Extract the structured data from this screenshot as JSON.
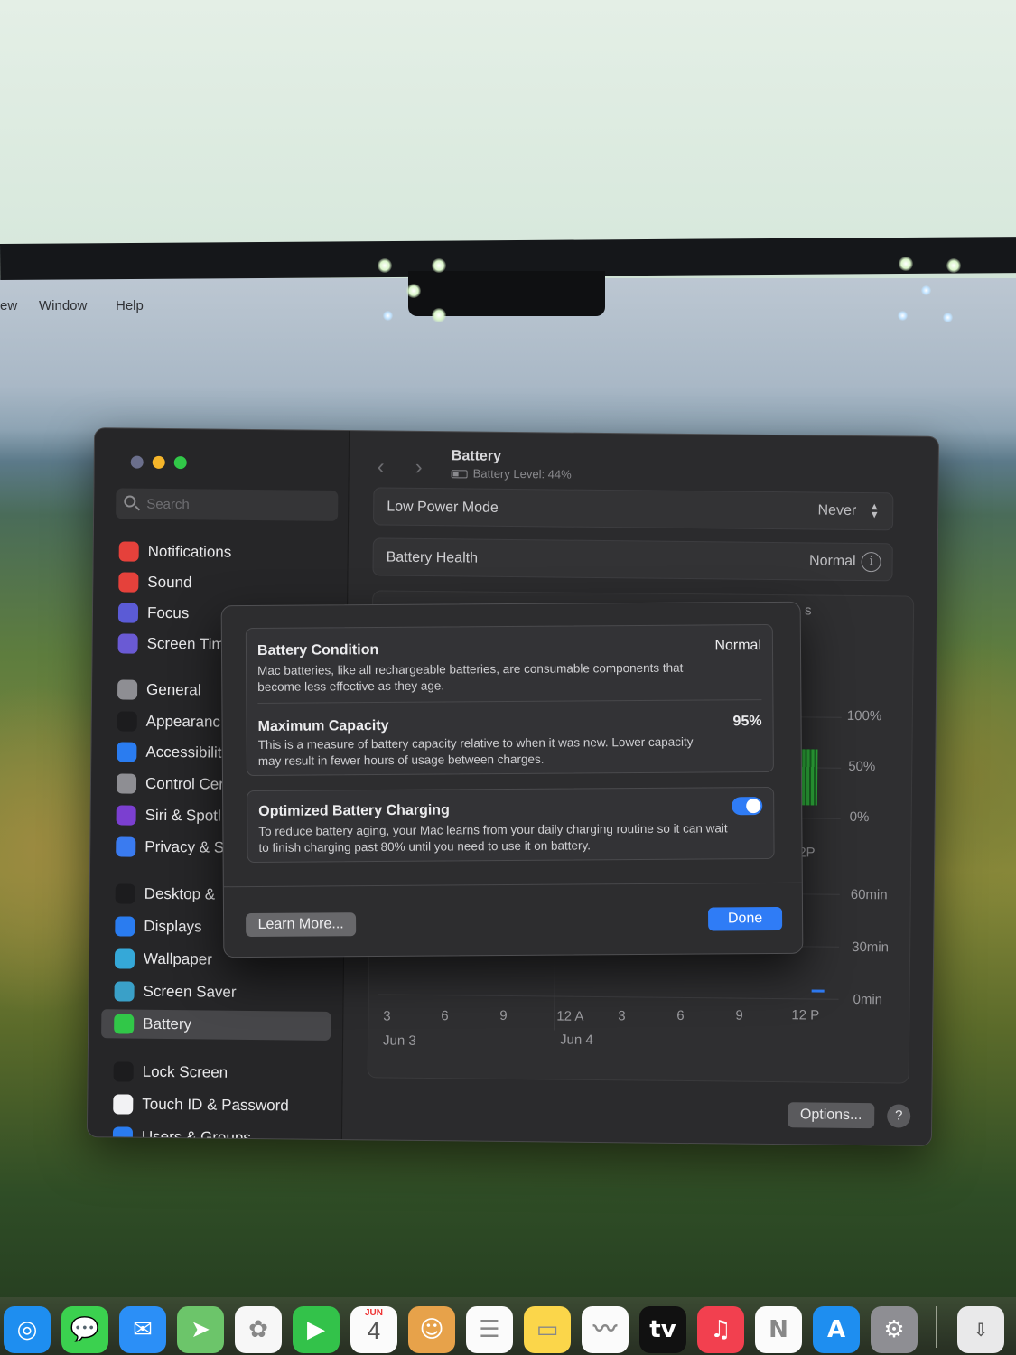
{
  "menubar": {
    "items": [
      "ew",
      "Window",
      "Help"
    ]
  },
  "window": {
    "title": "Battery",
    "subtitle": "Battery Level: 44%",
    "traffic_lights": {
      "close": "#6b6f8c",
      "minimize": "#f5b52a",
      "zoom": "#31c748"
    },
    "search": {
      "placeholder": "Search"
    },
    "sidebar": [
      {
        "label": "Notifications",
        "icon": "bell-icon",
        "color": "#e5413b"
      },
      {
        "label": "Sound",
        "icon": "speaker-icon",
        "color": "#e5413b"
      },
      {
        "label": "Focus",
        "icon": "moon-icon",
        "color": "#5b5bd6"
      },
      {
        "label": "Screen Tim",
        "icon": "hourglass-icon",
        "color": "#6a5ad4"
      },
      {
        "label": "General",
        "icon": "gear-icon",
        "color": "#8e8e93"
      },
      {
        "label": "Appearanc",
        "icon": "appearance-icon",
        "color": "#1c1c1e"
      },
      {
        "label": "Accessibilit",
        "icon": "accessibility-icon",
        "color": "#2a7cf0"
      },
      {
        "label": "Control Cer",
        "icon": "toggles-icon",
        "color": "#8e8e93"
      },
      {
        "label": "Siri & Spotl",
        "icon": "siri-icon",
        "color": "#7b3fd0"
      },
      {
        "label": "Privacy & S",
        "icon": "hand-icon",
        "color": "#3a7bf0"
      },
      {
        "label": "Desktop &",
        "icon": "desktop-icon",
        "color": "#1c1c1e"
      },
      {
        "label": "Displays",
        "icon": "sun-icon",
        "color": "#2a7cf0"
      },
      {
        "label": "Wallpaper",
        "icon": "flower-icon",
        "color": "#35a8d8"
      },
      {
        "label": "Screen Saver",
        "icon": "screensaver-icon",
        "color": "#3aa0c8"
      },
      {
        "label": "Battery",
        "icon": "battery-icon",
        "color": "#31c748",
        "selected": true
      },
      {
        "label": "Lock Screen",
        "icon": "lock-icon",
        "color": "#1c1c1e"
      },
      {
        "label": "Touch ID & Password",
        "icon": "fingerprint-icon",
        "color": "#f2f2f4"
      },
      {
        "label": "Users & Groups",
        "icon": "users-icon",
        "color": "#2a7cf0"
      }
    ],
    "rows": {
      "low_power": {
        "label": "Low Power Mode",
        "value": "Never"
      },
      "health": {
        "label": "Battery Health",
        "value": "Normal"
      },
      "tab_fragment": "s"
    },
    "chart": {
      "level_ticks": [
        "100%",
        "50%",
        "0%"
      ],
      "level_x_fragment": "2P",
      "usage_ticks": [
        "60min",
        "30min",
        "0min"
      ],
      "x_ticks": [
        "3",
        "6",
        "9",
        "12 A",
        "3",
        "6",
        "9",
        "12 P"
      ],
      "dates": [
        "Jun 3",
        "Jun 4"
      ]
    },
    "options_label": "Options...",
    "help_label": "?"
  },
  "sheet": {
    "condition": {
      "title": "Battery Condition",
      "value": "Normal",
      "desc": "Mac batteries, like all rechargeable batteries, are consumable components that become less effective as they age."
    },
    "capacity": {
      "title": "Maximum Capacity",
      "value": "95%",
      "desc": "This is a measure of battery capacity relative to when it was new. Lower capacity may result in fewer hours of usage between charges."
    },
    "optimized": {
      "title": "Optimized Battery Charging",
      "enabled": true,
      "desc": "To reduce battery aging, your Mac learns from your daily charging routine so it can wait to finish charging past 80% until you need to use it on battery."
    },
    "learn_more": "Learn More...",
    "done": "Done"
  },
  "dock": {
    "apps": [
      {
        "name": "safari-icon",
        "color": "#1e8ef0",
        "glyph": "◎"
      },
      {
        "name": "messages-icon",
        "color": "#3bd14f",
        "glyph": "💬"
      },
      {
        "name": "mail-icon",
        "color": "#2b8ff7",
        "glyph": "✉"
      },
      {
        "name": "maps-icon",
        "color": "#6cc56a",
        "glyph": "➤"
      },
      {
        "name": "photos-icon",
        "color": "#f7f7f7",
        "glyph": "✿"
      },
      {
        "name": "facetime-icon",
        "color": "#33c24a",
        "glyph": "▶"
      },
      {
        "name": "calendar-icon",
        "color": "#fbfbfb",
        "glyph": ""
      },
      {
        "name": "contacts-icon",
        "color": "#e7a24a",
        "glyph": "☺"
      },
      {
        "name": "reminders-icon",
        "color": "#fbfbfb",
        "glyph": "☰"
      },
      {
        "name": "notes-icon",
        "color": "#fbd64a",
        "glyph": "▭"
      },
      {
        "name": "freeform-icon",
        "color": "#fbfbfb",
        "glyph": "〰"
      },
      {
        "name": "appletv-icon",
        "color": "#111111",
        "glyph": "tv"
      },
      {
        "name": "music-icon",
        "color": "#f2404f",
        "glyph": "♫"
      },
      {
        "name": "news-icon",
        "color": "#fbfbfb",
        "glyph": "N"
      },
      {
        "name": "appstore-icon",
        "color": "#1e8ef0",
        "glyph": "A"
      },
      {
        "name": "system-settings-icon",
        "color": "#8e8e93",
        "glyph": "⚙"
      }
    ],
    "calendar_month": "JUN",
    "calendar_day": "4"
  }
}
